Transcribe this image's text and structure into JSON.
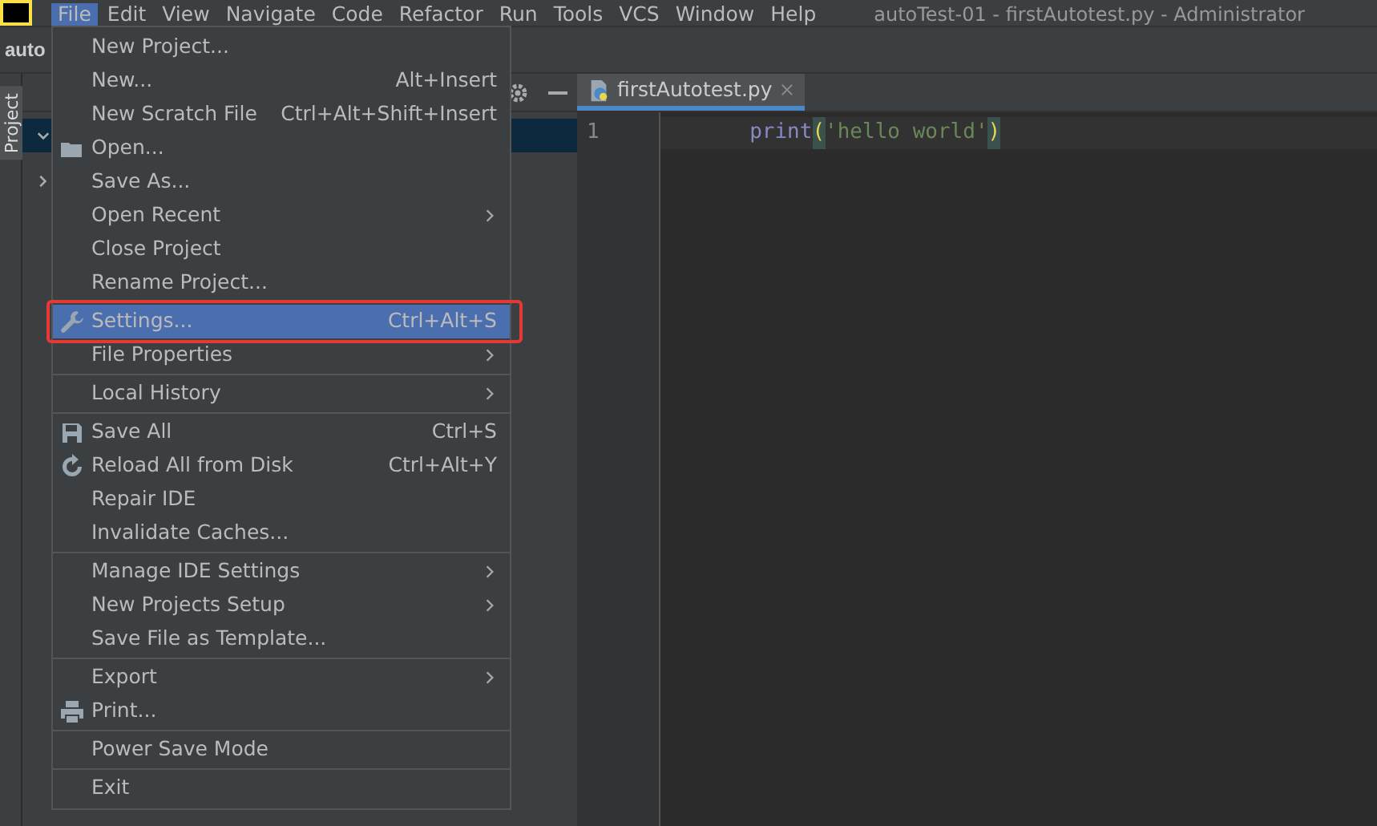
{
  "window": {
    "title": "autoTest-01 - firstAutotest.py - Administrator"
  },
  "menubar": [
    {
      "label": "File",
      "selected": true
    },
    {
      "label": "Edit",
      "selected": false
    },
    {
      "label": "View",
      "selected": false
    },
    {
      "label": "Navigate",
      "selected": false
    },
    {
      "label": "Code",
      "selected": false
    },
    {
      "label": "Refactor",
      "selected": false
    },
    {
      "label": "Run",
      "selected": false
    },
    {
      "label": "Tools",
      "selected": false
    },
    {
      "label": "VCS",
      "selected": false
    },
    {
      "label": "Window",
      "selected": false
    },
    {
      "label": "Help",
      "selected": false
    }
  ],
  "navbar": {
    "project": "auto"
  },
  "side_stripe": {
    "label": "Project"
  },
  "project_tree": [
    {
      "expanded": true,
      "selected": true
    },
    {
      "expanded": false,
      "selected": false
    }
  ],
  "editor": {
    "tabs": [
      {
        "label": "firstAutotest.py",
        "selected": true
      }
    ],
    "lines": [
      {
        "number": "1",
        "func": "print",
        "open": "(",
        "string": "'hello world'",
        "close": ")"
      }
    ]
  },
  "file_menu": {
    "sections": [
      [
        {
          "label": "New Project...",
          "selected": false
        },
        {
          "label": "New...",
          "shortcut": "Alt+Insert",
          "selected": false
        },
        {
          "label": "New Scratch File",
          "shortcut": "Ctrl+Alt+Shift+Insert",
          "selected": false
        },
        {
          "label": "Open...",
          "kind": "folder",
          "selected": false
        },
        {
          "label": "Save As...",
          "selected": false
        },
        {
          "label": "Open Recent",
          "submenu": true,
          "selected": false
        },
        {
          "label": "Close Project",
          "selected": false
        },
        {
          "label": "Rename Project...",
          "selected": false
        }
      ],
      [
        {
          "label": "Settings...",
          "shortcut": "Ctrl+Alt+S",
          "kind": "wrench",
          "selected": true,
          "outlined": true
        },
        {
          "label": "File Properties",
          "submenu": true,
          "selected": false
        }
      ],
      [
        {
          "label": "Local History",
          "submenu": true,
          "selected": false
        }
      ],
      [
        {
          "label": "Save All",
          "shortcut": "Ctrl+S",
          "kind": "disk",
          "selected": false
        },
        {
          "label": "Reload All from Disk",
          "shortcut": "Ctrl+Alt+Y",
          "kind": "reload",
          "selected": false
        },
        {
          "label": "Repair IDE",
          "selected": false
        },
        {
          "label": "Invalidate Caches...",
          "selected": false
        }
      ],
      [
        {
          "label": "Manage IDE Settings",
          "submenu": true,
          "selected": false
        },
        {
          "label": "New Projects Setup",
          "submenu": true,
          "selected": false
        },
        {
          "label": "Save File as Template...",
          "selected": false
        }
      ],
      [
        {
          "label": "Export",
          "submenu": true,
          "selected": false
        },
        {
          "label": "Print...",
          "kind": "printer",
          "selected": false
        }
      ],
      [
        {
          "label": "Power Save Mode",
          "selected": false
        }
      ],
      [
        {
          "label": "Exit",
          "selected": false
        }
      ]
    ]
  }
}
